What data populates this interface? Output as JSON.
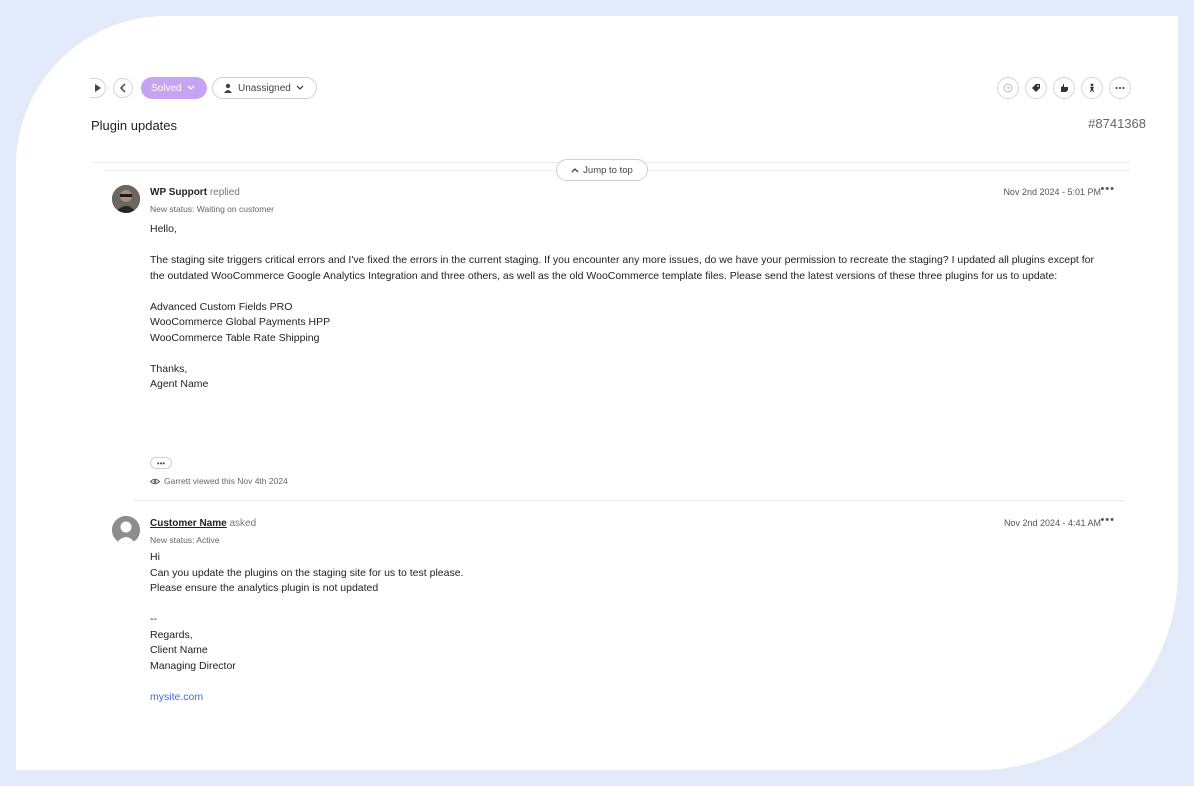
{
  "toolbar": {
    "status_label": "Solved",
    "assignee_label": "Unassigned",
    "icons": [
      "play-icon",
      "back-icon",
      "clock-icon",
      "tag-icon",
      "hand-icon",
      "person-icon",
      "more-icon"
    ]
  },
  "ticket": {
    "title": "Plugin updates",
    "id": "#8741368"
  },
  "jump_to_top": "Jump to top",
  "messages": [
    {
      "author": "WP Support",
      "action": "replied",
      "status": "New status: Waiting on customer",
      "timestamp": "Nov 2nd 2024 - 5:01 PM",
      "lines": {
        "l1": "Hello,",
        "l2": "The staging site triggers critical errors and I've fixed the errors in the current staging. If you encounter any more issues, do we have your permission to recreate the staging? I updated all plugins except for the outdated WooCommerce Google Analytics Integration and three others, as well as the old WooCommerce template files. Please send the latest versions of these three plugins for us to update:",
        "l3": "Advanced Custom Fields PRO",
        "l4": "WooCommerce Global Payments HPP",
        "l5": "WooCommerce Table Rate Shipping",
        "l6": "Thanks,",
        "l7": "Agent Name"
      },
      "viewed": "Garrett viewed this Nov 4th 2024"
    },
    {
      "author": "Customer Name",
      "action": "asked",
      "status": "New status: Active",
      "timestamp": "Nov 2nd 2024 - 4:41 AM",
      "lines": {
        "l1": "Hi",
        "l2": "Can you update the plugins on the staging site for us to test please.",
        "l3": "Please ensure the analytics plugin is not updated",
        "l4": "--",
        "l5": "Regards,",
        "l6": "Client Name",
        "l7": "Managing Director",
        "link": "mysite.com"
      }
    }
  ],
  "colors": {
    "accent": "#c6a4f3",
    "frame": "#e3ebfb",
    "link": "#3a6fd8"
  }
}
